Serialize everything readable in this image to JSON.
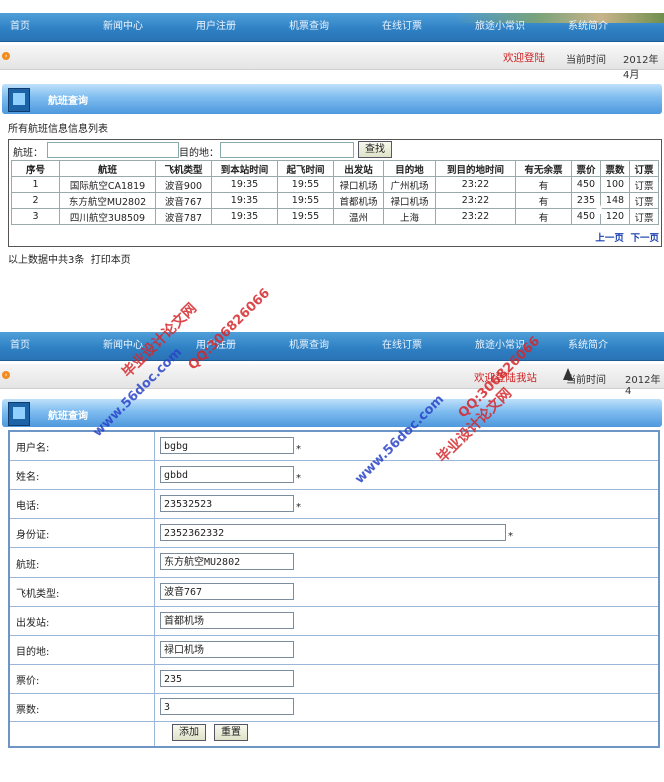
{
  "nav": [
    "首页",
    "新闻中心",
    "用户注册",
    "机票查询",
    "在线订票",
    "旅途小常识",
    "系统简介"
  ],
  "top_status": {
    "welcome": "欢迎登陆",
    "time_label": "当前时间",
    "time_value": "2012年4月"
  },
  "bottom_status": {
    "welcome": "欢迎登陆我站",
    "time_label": "当前时间",
    "time_value": "2012年4"
  },
  "search_section": {
    "title": "航班查询",
    "list_caption": "所有航班信息信息列表",
    "flight_label": "航班：",
    "dest_label": "目的地：",
    "search_button": "查找",
    "columns": [
      "序号",
      "航班",
      "飞机类型",
      "到本站时间",
      "起飞时间",
      "出发站",
      "目的地",
      "到目的地时间",
      "有无余票",
      "票价",
      "票数",
      "订票"
    ],
    "rows": [
      [
        "1",
        "国际航空CA1819",
        "波音900",
        "19:35",
        "19:55",
        "禄口机场",
        "广州机场",
        "23:22",
        "有",
        "450",
        "100",
        "订票"
      ],
      [
        "2",
        "东方航空MU2802",
        "波音767",
        "19:35",
        "19:55",
        "首都机场",
        "禄口机场",
        "23:22",
        "有",
        "235",
        "148",
        "订票"
      ],
      [
        "3",
        "四川航空3U8509",
        "波音787",
        "19:35",
        "19:55",
        "温州",
        "上海",
        "23:22",
        "有",
        "450",
        "120",
        "订票"
      ]
    ],
    "prev_page": "上一页",
    "next_page": "下一页",
    "footer_count": "以上数据中共3条",
    "footer_print": "打印本页"
  },
  "form_section": {
    "title": "航班查询",
    "fields": [
      {
        "label": "用户名:",
        "value": "bgbg",
        "required": "*"
      },
      {
        "label": "姓名:",
        "value": "gbbd",
        "required": "*"
      },
      {
        "label": "电话:",
        "value": "23532523",
        "required": "*"
      },
      {
        "label": "身份证:",
        "value": "2352362332",
        "required": "*"
      },
      {
        "label": "航班:",
        "value": "东方航空MU2802",
        "required": ""
      },
      {
        "label": "飞机类型:",
        "value": "波音767",
        "required": ""
      },
      {
        "label": "出发站:",
        "value": "首都机场",
        "required": ""
      },
      {
        "label": "目的地:",
        "value": "禄口机场",
        "required": ""
      },
      {
        "label": "票价:",
        "value": "235",
        "required": ""
      },
      {
        "label": "票数:",
        "value": "3",
        "required": ""
      }
    ],
    "add_button": "添加",
    "reset_button": "重置"
  },
  "watermarks": {
    "site": "www.56doc.com",
    "qq": "QQ:306826066",
    "name": "毕业设计论文网"
  },
  "colors": {
    "nav": "#2e7fc3",
    "welcome": "#d2201f",
    "form_border": "#6d96c6",
    "watermark_blue": "#2a44c8",
    "watermark_red": "#d5272b"
  }
}
